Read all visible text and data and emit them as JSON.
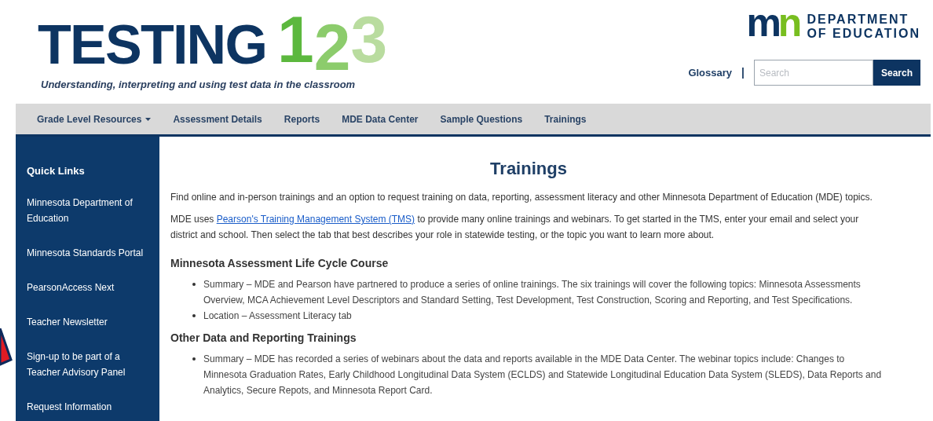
{
  "header": {
    "logo": {
      "word": "TESTING",
      "digits": [
        "1",
        "2",
        "3"
      ],
      "tagline": "Understanding, interpreting and using test data in the classroom"
    },
    "agency": {
      "mark": [
        "m",
        "n"
      ],
      "lines": [
        "DEPARTMENT",
        "OF EDUCATION"
      ]
    },
    "glossary": "Glossary",
    "separator": "|",
    "search": {
      "placeholder": "Search",
      "button": "Search"
    }
  },
  "nav": [
    {
      "label": "Grade Level Resources",
      "has_menu": true
    },
    {
      "label": "Assessment Details",
      "has_menu": false
    },
    {
      "label": "Reports",
      "has_menu": false
    },
    {
      "label": "MDE Data Center",
      "has_menu": false
    },
    {
      "label": "Sample Questions",
      "has_menu": false
    },
    {
      "label": "Trainings",
      "has_menu": false
    }
  ],
  "sidebar": {
    "title": "Quick Links",
    "items": [
      "Minnesota Department of Education",
      "Minnesota Standards Portal",
      "PearsonAccess Next",
      "Teacher Newsletter",
      "Sign-up to be part of a Teacher Advisory Panel",
      "Request Information"
    ]
  },
  "content": {
    "title": "Trainings",
    "paragraphs": [
      {
        "before": "Find online and in-person trainings and an option to request training on data, reporting, assessment literacy and other Minnesota Department of Education (MDE) topics."
      },
      {
        "before": "MDE uses ",
        "link": "Pearson's Training Management System (TMS)",
        "after": " to provide many online trainings and webinars. To get started in the TMS, enter your email and select your district and school. Then select the tab that best describes your role in statewide testing, or the topic you want to learn more about."
      }
    ],
    "sections": [
      {
        "heading": "Minnesota Assessment Life Cycle Course",
        "bullets": [
          "Summary – MDE and Pearson have partnered to produce a series of online trainings. The six trainings will cover the following topics: Minnesota Assessments Overview, MCA Achievement Level Descriptors and Standard Setting, Test Development, Test Construction, Scoring and Reporting, and Test Specifications.",
          "Location – Assessment Literacy tab"
        ]
      },
      {
        "heading": "Other Data and Reporting Trainings",
        "bullets": [
          "Summary – MDE has recorded a series of webinars about the data and reports available in the MDE Data Center. The webinar topics include: Changes to Minnesota Graduation Rates, Early Childhood Longitudinal Data System (ECLDS) and Statewide Longitudinal Education Data System (SLEDS), Data Reports and Analytics, Secure Repots, and Minnesota Report Card."
        ]
      }
    ]
  }
}
